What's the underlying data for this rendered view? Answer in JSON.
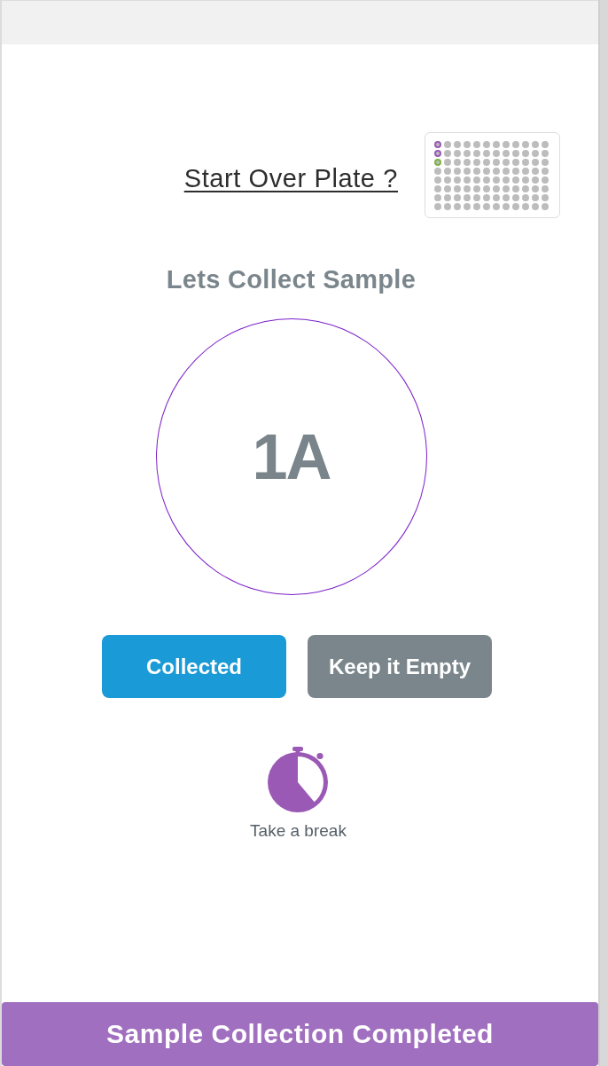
{
  "start_over_link": {
    "label": "Start Over Plate ?"
  },
  "plate": {
    "rows": [
      {
        "wells": [
          {
            "color": "#9b59b6"
          },
          {
            "color": "#bdbdbd"
          },
          {
            "color": "#bdbdbd"
          },
          {
            "color": "#bdbdbd"
          },
          {
            "color": "#bdbdbd"
          },
          {
            "color": "#bdbdbd"
          },
          {
            "color": "#bdbdbd"
          },
          {
            "color": "#bdbdbd"
          },
          {
            "color": "#bdbdbd"
          },
          {
            "color": "#bdbdbd"
          },
          {
            "color": "#bdbdbd"
          },
          {
            "color": "#bdbdbd"
          }
        ]
      },
      {
        "wells": [
          {
            "color": "#9b59b6"
          },
          {
            "color": "#bdbdbd"
          },
          {
            "color": "#bdbdbd"
          },
          {
            "color": "#bdbdbd"
          },
          {
            "color": "#bdbdbd"
          },
          {
            "color": "#bdbdbd"
          },
          {
            "color": "#bdbdbd"
          },
          {
            "color": "#bdbdbd"
          },
          {
            "color": "#bdbdbd"
          },
          {
            "color": "#bdbdbd"
          },
          {
            "color": "#bdbdbd"
          },
          {
            "color": "#bdbdbd"
          }
        ]
      },
      {
        "wells": [
          {
            "color": "#7cb342"
          },
          {
            "color": "#bdbdbd"
          },
          {
            "color": "#bdbdbd"
          },
          {
            "color": "#bdbdbd"
          },
          {
            "color": "#bdbdbd"
          },
          {
            "color": "#bdbdbd"
          },
          {
            "color": "#bdbdbd"
          },
          {
            "color": "#bdbdbd"
          },
          {
            "color": "#bdbdbd"
          },
          {
            "color": "#bdbdbd"
          },
          {
            "color": "#bdbdbd"
          },
          {
            "color": "#bdbdbd"
          }
        ]
      },
      {
        "wells": [
          {
            "color": "#bdbdbd"
          },
          {
            "color": "#bdbdbd"
          },
          {
            "color": "#bdbdbd"
          },
          {
            "color": "#bdbdbd"
          },
          {
            "color": "#bdbdbd"
          },
          {
            "color": "#bdbdbd"
          },
          {
            "color": "#bdbdbd"
          },
          {
            "color": "#bdbdbd"
          },
          {
            "color": "#bdbdbd"
          },
          {
            "color": "#bdbdbd"
          },
          {
            "color": "#bdbdbd"
          },
          {
            "color": "#bdbdbd"
          }
        ]
      },
      {
        "wells": [
          {
            "color": "#bdbdbd"
          },
          {
            "color": "#bdbdbd"
          },
          {
            "color": "#bdbdbd"
          },
          {
            "color": "#bdbdbd"
          },
          {
            "color": "#bdbdbd"
          },
          {
            "color": "#bdbdbd"
          },
          {
            "color": "#bdbdbd"
          },
          {
            "color": "#bdbdbd"
          },
          {
            "color": "#bdbdbd"
          },
          {
            "color": "#bdbdbd"
          },
          {
            "color": "#bdbdbd"
          },
          {
            "color": "#bdbdbd"
          }
        ]
      },
      {
        "wells": [
          {
            "color": "#bdbdbd"
          },
          {
            "color": "#bdbdbd"
          },
          {
            "color": "#bdbdbd"
          },
          {
            "color": "#bdbdbd"
          },
          {
            "color": "#bdbdbd"
          },
          {
            "color": "#bdbdbd"
          },
          {
            "color": "#bdbdbd"
          },
          {
            "color": "#bdbdbd"
          },
          {
            "color": "#bdbdbd"
          },
          {
            "color": "#bdbdbd"
          },
          {
            "color": "#bdbdbd"
          },
          {
            "color": "#bdbdbd"
          }
        ]
      },
      {
        "wells": [
          {
            "color": "#bdbdbd"
          },
          {
            "color": "#bdbdbd"
          },
          {
            "color": "#bdbdbd"
          },
          {
            "color": "#bdbdbd"
          },
          {
            "color": "#bdbdbd"
          },
          {
            "color": "#bdbdbd"
          },
          {
            "color": "#bdbdbd"
          },
          {
            "color": "#bdbdbd"
          },
          {
            "color": "#bdbdbd"
          },
          {
            "color": "#bdbdbd"
          },
          {
            "color": "#bdbdbd"
          },
          {
            "color": "#bdbdbd"
          }
        ]
      },
      {
        "wells": [
          {
            "color": "#bdbdbd"
          },
          {
            "color": "#bdbdbd"
          },
          {
            "color": "#bdbdbd"
          },
          {
            "color": "#bdbdbd"
          },
          {
            "color": "#bdbdbd"
          },
          {
            "color": "#bdbdbd"
          },
          {
            "color": "#bdbdbd"
          },
          {
            "color": "#bdbdbd"
          },
          {
            "color": "#bdbdbd"
          },
          {
            "color": "#bdbdbd"
          },
          {
            "color": "#bdbdbd"
          },
          {
            "color": "#bdbdbd"
          }
        ]
      }
    ]
  },
  "prompt": "Lets Collect Sample",
  "current_well": "1A",
  "buttons": [
    {
      "label": "Collected",
      "kind": "primary"
    },
    {
      "label": "Keep it Empty",
      "kind": "secondary"
    }
  ],
  "break_button": {
    "label": "Take a break"
  },
  "footer_button": {
    "label": "Sample Collection Completed"
  }
}
